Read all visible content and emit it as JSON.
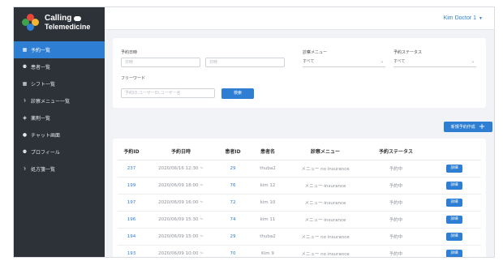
{
  "brand": {
    "name": "Calling",
    "subtitle": "Telemedicine"
  },
  "header": {
    "user_menu": "Kim Doctor 1"
  },
  "sidebar": {
    "items": [
      {
        "label": "予約一覧",
        "icon": "calendar-icon",
        "glyph": "▦"
      },
      {
        "label": "患者一覧",
        "icon": "person-icon",
        "glyph": "⚉"
      },
      {
        "label": "シフト一覧",
        "icon": "shift-calendar-icon",
        "glyph": "▦"
      },
      {
        "label": "診察メニュー一覧",
        "icon": "stethoscope-icon",
        "glyph": "⚕"
      },
      {
        "label": "薬剤一覧",
        "icon": "pill-icon",
        "glyph": "◈"
      },
      {
        "label": "チャット画面",
        "icon": "chat-icon",
        "glyph": "●"
      },
      {
        "label": "プロフィール",
        "icon": "profile-icon",
        "glyph": "⚉"
      },
      {
        "label": "処方箋一覧",
        "icon": "prescription-icon",
        "glyph": "⚕"
      }
    ]
  },
  "search": {
    "datetime_label": "予約日時",
    "date_from_placeholder": "日時",
    "date_to_placeholder": "日時",
    "menu_label": "診察メニュー",
    "menu_value": "すべて",
    "status_label": "予約ステータス",
    "status_value": "すべて",
    "freeword_label": "フリーワード",
    "freeword_placeholder": "予約ID,ユーザーID,ユーザー名",
    "search_button": "検索"
  },
  "new_button": "新規予約作成",
  "table": {
    "columns": [
      "予約ID",
      "予約日時",
      "患者ID",
      "患者名",
      "診察メニュー",
      "予約ステータス",
      ""
    ],
    "rows": [
      {
        "id": "237",
        "datetime": "2020/06/16 12:30 ~",
        "patient_id": "29",
        "patient_name": "thuba2",
        "menu": "メニュー no insurance",
        "status": "予約中",
        "action": "詳細"
      },
      {
        "id": "199",
        "datetime": "2020/06/09 18:00 ~",
        "patient_id": "76",
        "patient_name": "kim 12",
        "menu": "メニュー-insurance",
        "status": "予約中",
        "action": "詳細"
      },
      {
        "id": "197",
        "datetime": "2020/06/09 16:00 ~",
        "patient_id": "72",
        "patient_name": "kim 10",
        "menu": "メニュー-insurance",
        "status": "予約中",
        "action": "詳細"
      },
      {
        "id": "196",
        "datetime": "2020/06/09 15:30 ~",
        "patient_id": "74",
        "patient_name": "kim 11",
        "menu": "メニュー-insurance",
        "status": "予約中",
        "action": "詳細"
      },
      {
        "id": "194",
        "datetime": "2020/06/09 15:00 ~",
        "patient_id": "29",
        "patient_name": "thuba2",
        "menu": "メニュー no insurance",
        "status": "予約中",
        "action": "詳細"
      },
      {
        "id": "193",
        "datetime": "2020/06/09 10:00 ~",
        "patient_id": "70",
        "patient_name": "Kim 9",
        "menu": "メニュー no insurance",
        "status": "予約中",
        "action": "詳細"
      }
    ]
  },
  "colors": {
    "primary": "#2e7fd3",
    "sidebar": "#2d3138",
    "background": "#f1f3f7"
  }
}
